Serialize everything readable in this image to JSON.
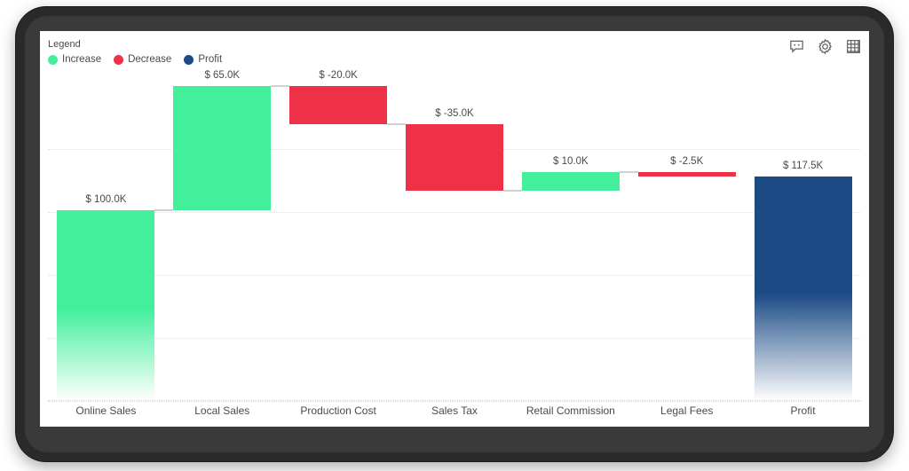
{
  "legend": {
    "title": "Legend",
    "items": [
      {
        "label": "Increase",
        "color": "#44EF9C",
        "name": "legend-increase"
      },
      {
        "label": "Decrease",
        "color": "#EE3147",
        "name": "legend-decrease"
      },
      {
        "label": "Profit",
        "color": "#1B4A85",
        "name": "legend-profit"
      }
    ]
  },
  "actions": [
    {
      "name": "comment-icon",
      "title": "Comment"
    },
    {
      "name": "gear-icon",
      "title": "Settings"
    },
    {
      "name": "table-grid-icon",
      "title": "Show as a table"
    }
  ],
  "chart_data": {
    "type": "bar",
    "subtype": "waterfall",
    "title": "",
    "xlabel": "",
    "ylabel": "",
    "currency": "$",
    "units": "K",
    "ylim": [
      0,
      165
    ],
    "grid": true,
    "legend_position": "top-left",
    "categories": [
      "Online Sales",
      "Local Sales",
      "Production Cost",
      "Sales Tax",
      "Retail Commission",
      "Legal Fees",
      "Profit"
    ],
    "labels": [
      "$ 100.0K",
      "$ 65.0K",
      "$ -20.0K",
      "$ -35.0K",
      "$ 10.0K",
      "$ -2.5K",
      "$ 117.5K"
    ],
    "values": [
      100.0,
      65.0,
      -20.0,
      -35.0,
      10.0,
      -2.5,
      117.5
    ],
    "series": [
      {
        "name": "Waterfall",
        "points": [
          {
            "category": "Online Sales",
            "value": 100.0,
            "start": 0.0,
            "end": 100.0,
            "kind": "increase",
            "label": "$ 100.0K"
          },
          {
            "category": "Local Sales",
            "value": 65.0,
            "start": 100.0,
            "end": 165.0,
            "kind": "increase",
            "label": "$ 65.0K"
          },
          {
            "category": "Production Cost",
            "value": -20.0,
            "start": 165.0,
            "end": 145.0,
            "kind": "decrease",
            "label": "$ -20.0K"
          },
          {
            "category": "Sales Tax",
            "value": -35.0,
            "start": 145.0,
            "end": 110.0,
            "kind": "decrease",
            "label": "$ -35.0K"
          },
          {
            "category": "Retail Commission",
            "value": 10.0,
            "start": 110.0,
            "end": 120.0,
            "kind": "increase",
            "label": "$ 10.0K"
          },
          {
            "category": "Legal Fees",
            "value": -2.5,
            "start": 120.0,
            "end": 117.5,
            "kind": "decrease",
            "label": "$ -2.5K"
          },
          {
            "category": "Profit",
            "value": 117.5,
            "start": 0.0,
            "end": 117.5,
            "kind": "total",
            "label": "$ 117.5K"
          }
        ]
      }
    ],
    "colors": {
      "increase": "#44EF9C",
      "decrease": "#EE3147",
      "total": "#1B4A85",
      "gridline": "#e3e3e3",
      "text": "#4a4a4a"
    }
  }
}
